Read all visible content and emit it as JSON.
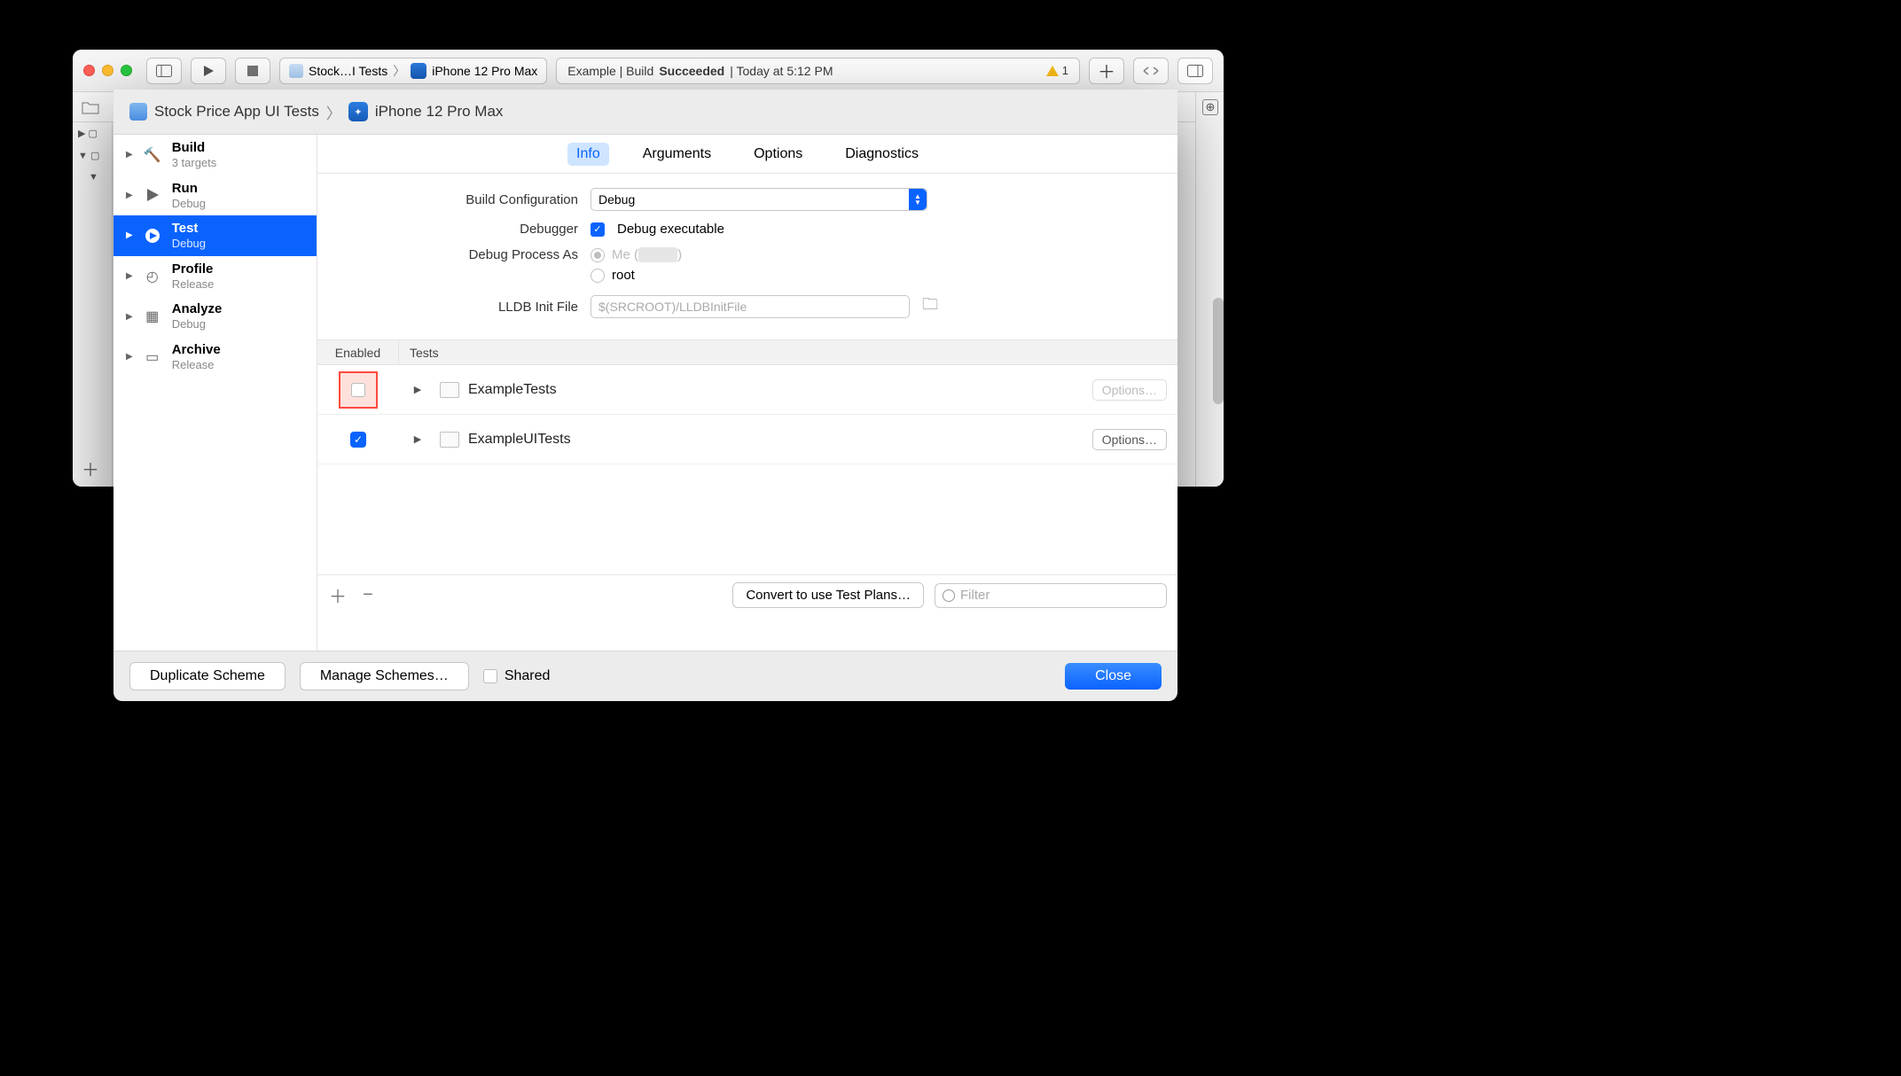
{
  "toolbar": {
    "scheme_label": "Stock…I Tests",
    "device_label": "iPhone 12 Pro Max",
    "status_prefix": "Example | Build ",
    "status_bold": "Succeeded",
    "status_suffix": " | Today at 5:12 PM",
    "warning_count": "1"
  },
  "breadcrumb": {
    "scheme": "Stock Price App UI Tests",
    "device": "iPhone 12 Pro Max"
  },
  "sidebar": [
    {
      "title": "Build",
      "sub": "3 targets"
    },
    {
      "title": "Run",
      "sub": "Debug"
    },
    {
      "title": "Test",
      "sub": "Debug"
    },
    {
      "title": "Profile",
      "sub": "Release"
    },
    {
      "title": "Analyze",
      "sub": "Debug"
    },
    {
      "title": "Archive",
      "sub": "Release"
    }
  ],
  "tabs": {
    "info": "Info",
    "arguments": "Arguments",
    "options": "Options",
    "diagnostics": "Diagnostics"
  },
  "form": {
    "build_config_label": "Build Configuration",
    "build_config_value": "Debug",
    "debugger_label": "Debugger",
    "debug_exec": "Debug executable",
    "debug_process_label": "Debug Process As",
    "me_label": "Me (",
    "me_suffix": ")",
    "root_label": "root",
    "lldb_label": "LLDB Init File",
    "lldb_placeholder": "$(SRCROOT)/LLDBInitFile"
  },
  "tests": {
    "col_enabled": "Enabled",
    "col_tests": "Tests",
    "rows": [
      {
        "name": "ExampleTests",
        "options": "Options…"
      },
      {
        "name": "ExampleUITests",
        "options": "Options…"
      }
    ],
    "convert_btn": "Convert to use Test Plans…",
    "filter_placeholder": "Filter"
  },
  "footer": {
    "duplicate": "Duplicate Scheme",
    "manage": "Manage Schemes…",
    "shared": "Shared",
    "close": "Close"
  }
}
